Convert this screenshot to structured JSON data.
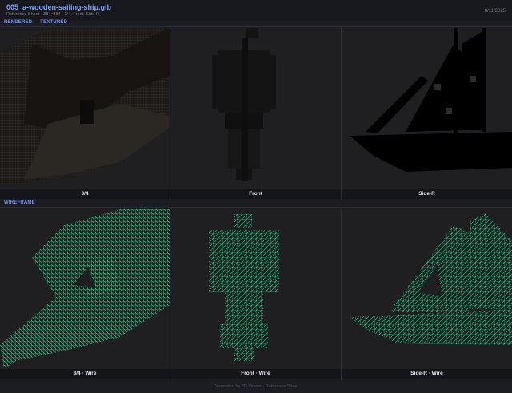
{
  "header": {
    "title": "005_a-wooden-sailing-ship.glb",
    "subtitle": "Reference Sheet  ·  384×384  ·  3/4, Front, Side-R",
    "date": "8/11/2025"
  },
  "sections": {
    "rendered": "RENDERED — TEXTURED",
    "wireframe": "WIREFRAME"
  },
  "views": {
    "rendered": [
      "3/4",
      "Front",
      "Side-R"
    ],
    "wireframe": [
      "3/4  ·  Wire",
      "Front  ·  Wire",
      "Side-R  ·  Wire"
    ]
  },
  "colors": {
    "background": "#1c1d22",
    "accent": "#6f95f2",
    "wire": "#2fd18a",
    "silhouette": "#000000"
  },
  "footer": "Generated by 3D Viewer · Reference Sheet"
}
